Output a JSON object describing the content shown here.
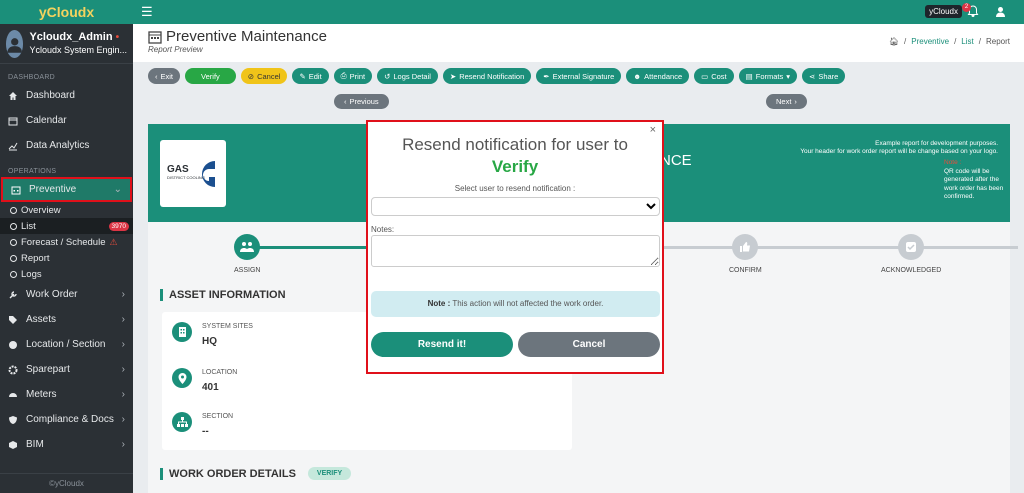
{
  "brand": "yCloudx",
  "user": {
    "name": "Ycloudx_Admin",
    "role": "Ycloudx System Engin..."
  },
  "sidebar": {
    "section_dashboard": "DASHBOARD",
    "section_operations": "OPERATIONS",
    "top_items": [
      {
        "label": "Dashboard",
        "icon": "home-icon"
      },
      {
        "label": "Calendar",
        "icon": "calendar-icon"
      },
      {
        "label": "Data Analytics",
        "icon": "chart-icon"
      }
    ],
    "preventive": {
      "label": "Preventive",
      "icon": "calendar-grid-icon"
    },
    "sub_items": [
      {
        "label": "Overview"
      },
      {
        "label": "List",
        "badge": "3970"
      },
      {
        "label": "Forecast / Schedule",
        "warn": "⚠"
      },
      {
        "label": "Report"
      },
      {
        "label": "Logs"
      }
    ],
    "bottom_items": [
      {
        "label": "Work Order",
        "icon": "wrench-icon"
      },
      {
        "label": "Assets",
        "icon": "tag-icon"
      },
      {
        "label": "Location / Section",
        "icon": "globe-icon"
      },
      {
        "label": "Sparepart",
        "icon": "gear-icon"
      },
      {
        "label": "Meters",
        "icon": "gauge-icon"
      },
      {
        "label": "Compliance & Docs",
        "icon": "shield-icon"
      },
      {
        "label": "BIM",
        "icon": "cube-icon"
      }
    ],
    "footer": "©yCloudx"
  },
  "topbar": {
    "chip": "yCloudx",
    "bell_count": "2"
  },
  "page": {
    "title": "Preventive Maintenance",
    "subtitle": "Report Preview",
    "breadcrumb": [
      "Preventive",
      "List",
      "Report"
    ],
    "separator": "/"
  },
  "toolbar": {
    "exit": "Exit",
    "verify": "Verify",
    "cancel": "Cancel",
    "edit": "Edit",
    "print": "Print",
    "logs_detail": "Logs Detail",
    "resend": "Resend Notification",
    "signature": "External Signature",
    "attendance": "Attendance",
    "cost": "Cost",
    "formats": "Formats",
    "share": "Share",
    "previous": "Previous",
    "next": "Next"
  },
  "report": {
    "header_title": "NCE",
    "logo_text": "GAS",
    "logo_sub": "DISTRICT COOLING",
    "note_line1": "Example report for development purposes.",
    "note_line2": "Your header for work order report will be change based on your logo.",
    "note_h": "Note :",
    "qr_note": "QR code will be generated after the work order has been confirmed.",
    "steps": [
      "ASSIGN",
      "CONFIRM",
      "ACKNOWLEDGED"
    ],
    "asset_title": "ASSET INFORMATION",
    "assets": [
      {
        "label": "SYSTEM SITES",
        "value": "HQ"
      },
      {
        "label": "LOCATION",
        "value": "401"
      },
      {
        "label": "SECTION",
        "value": "--"
      }
    ],
    "wo_title": "WORK ORDER DETAILS",
    "wo_status": "VERIFY"
  },
  "modal": {
    "title_line1": "Resend notification for user to",
    "title_verb": "Verify",
    "select_label": "Select user to resend notification :",
    "notes_label": "Notes:",
    "alert_bold": "Note :",
    "alert_text": " This action will not affected the work order.",
    "confirm": "Resend it!",
    "cancel": "Cancel",
    "close": "×"
  },
  "colors": {
    "accent": "#1b8f7a",
    "verify": "#28a745",
    "danger": "#e0101a",
    "warning": "#f0c419"
  }
}
